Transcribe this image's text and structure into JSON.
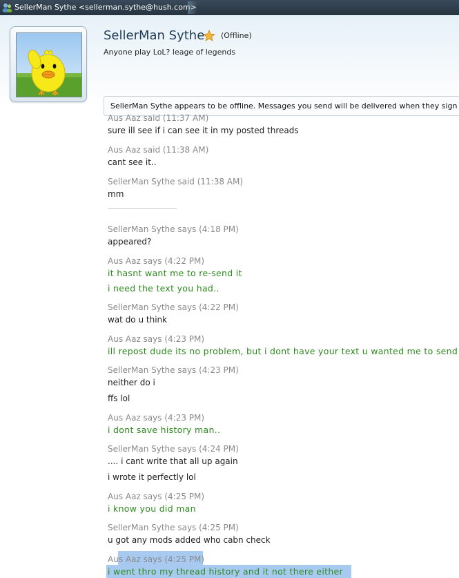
{
  "window": {
    "title": "SellerMan Sythe <sellerman.sythe@hush.com>"
  },
  "contact": {
    "name": "SellerMan Sythe",
    "status": "(Offline)",
    "personal_message": "Anyone play LoL? leage of legends",
    "avatar": "yellow-chick-avatar",
    "favorite_icon": "star-icon"
  },
  "notice": "SellerMan Sythe appears to be offline. Messages you send will be delivered when they sign in.",
  "colors": {
    "title_bar": "#26333f",
    "name_color": "#1f3a55",
    "timestamp_gray": "#8a8a8a",
    "green_text": "#2d8a1e",
    "selection": "#a8c9f0"
  },
  "messages": [
    {
      "header": "Aus Aaz said (11:37 AM)",
      "lines": [
        "sure ill see if i can see it in my posted threads"
      ]
    },
    {
      "header": "Aus Aaz said (11:38 AM)",
      "lines": [
        "cant see it.."
      ]
    },
    {
      "header": "SellerMan Sythe said (11:38 AM)",
      "lines": [
        "mm"
      ]
    },
    {
      "header": "SellerMan Sythe says (4:18 PM)",
      "lines": [
        "appeared?"
      ]
    },
    {
      "header": "Aus Aaz says (4:22 PM)",
      "lines": [
        "it hasnt want me to re-send it",
        "i need the text you had.."
      ]
    },
    {
      "header": "SellerMan Sythe says (4:22 PM)",
      "lines": [
        "wat do u think"
      ]
    },
    {
      "header": "Aus Aaz says (4:23 PM)",
      "lines": [
        "ill repost dude its no problem, but i dont have your text u wanted me to send"
      ]
    },
    {
      "header": "SellerMan Sythe says (4:23 PM)",
      "lines": [
        "neither do i",
        "ffs lol"
      ]
    },
    {
      "header": "Aus Aaz says (4:23 PM)",
      "lines": [
        "i dont save history man.."
      ]
    },
    {
      "header": "SellerMan Sythe says (4:24 PM)",
      "lines": [
        ".... i cant write that all up again",
        "i wrote it perfectly lol"
      ]
    },
    {
      "header": "Aus Aaz says (4:25 PM)",
      "lines": [
        "i know you did man"
      ]
    },
    {
      "header": "SellerMan Sythe says (4:25 PM)",
      "lines": [
        "u got any mods added who cabn check"
      ]
    },
    {
      "header": "Aus Aaz says (4:25 PM)",
      "lines": [
        "i went thro my thread history and it not there either"
      ]
    }
  ]
}
